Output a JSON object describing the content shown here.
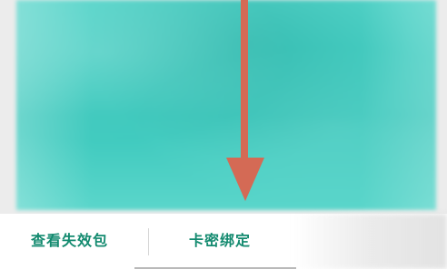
{
  "actions": {
    "view_expired_label": "查看失效包",
    "bind_card_label": "卡密绑定"
  },
  "colors": {
    "accent_text": "#138a6f",
    "banner": "#3fc9bd",
    "arrow": "#d46a55"
  },
  "icons": {
    "annotation": "down-arrow-icon"
  }
}
